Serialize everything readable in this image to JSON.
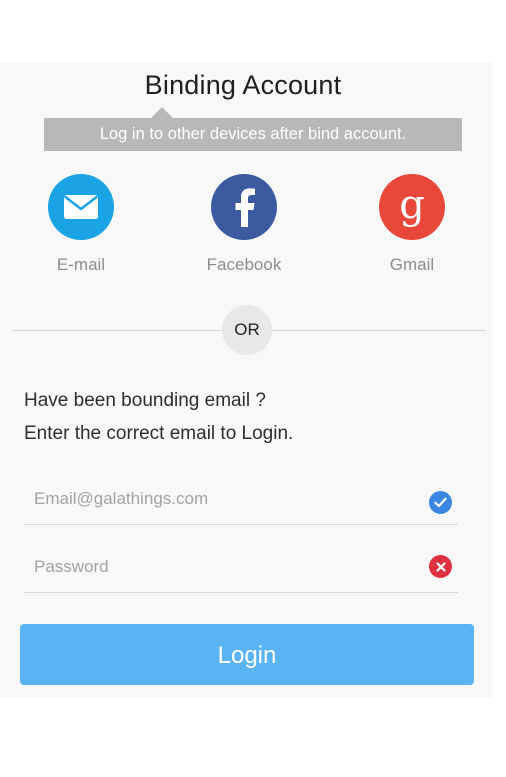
{
  "header": {
    "title": "Binding Account",
    "subtitle": "Log in to other devices after bind account."
  },
  "social": {
    "items": [
      {
        "id": "email",
        "label": "E-mail",
        "icon": "envelope-icon",
        "color": "#1aa3e5"
      },
      {
        "id": "facebook",
        "label": "Facebook",
        "icon": "facebook-f-icon",
        "color": "#3b5aa0"
      },
      {
        "id": "gmail",
        "label": "Gmail",
        "icon": "google-g-icon",
        "color": "#e8483a"
      }
    ]
  },
  "divider": {
    "label": "OR"
  },
  "info": {
    "line1": "Have been bounding email ?",
    "line2": "Enter the correct email  to Login."
  },
  "form": {
    "email": {
      "placeholder": "Email@galathings.com",
      "value": "",
      "status": "valid",
      "status_icon": "check-circle-icon",
      "status_color": "#3a86e0"
    },
    "password": {
      "placeholder": "Password",
      "value": "",
      "status": "invalid",
      "status_icon": "x-circle-icon",
      "status_color": "#e03140"
    }
  },
  "login": {
    "label": "Login",
    "color": "#5ab4f4"
  }
}
